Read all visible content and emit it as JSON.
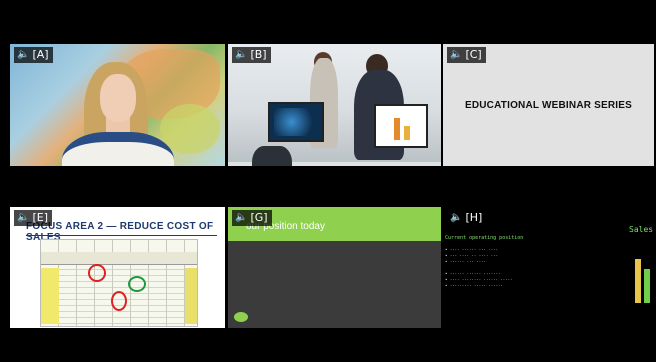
{
  "tiles": {
    "a": {
      "label": "[A]"
    },
    "b": {
      "label": "[B]"
    },
    "c": {
      "label": "[C]",
      "title": "EDUCATIONAL WEBINAR SERIES"
    },
    "e": {
      "label": "[E]",
      "title": "FOCUS AREA 2 — REDUCE COST OF SALES"
    },
    "g": {
      "label": "[G]",
      "heading": "our position today"
    },
    "h": {
      "label": "[H]",
      "sales_label": "Sales",
      "heading": "Current operating position"
    }
  },
  "icons": {
    "audio": "speaker-icon"
  },
  "colors": {
    "green_accent": "#8fd14f",
    "terminal_green": "#7fe06a",
    "black_bg": "#000000"
  }
}
